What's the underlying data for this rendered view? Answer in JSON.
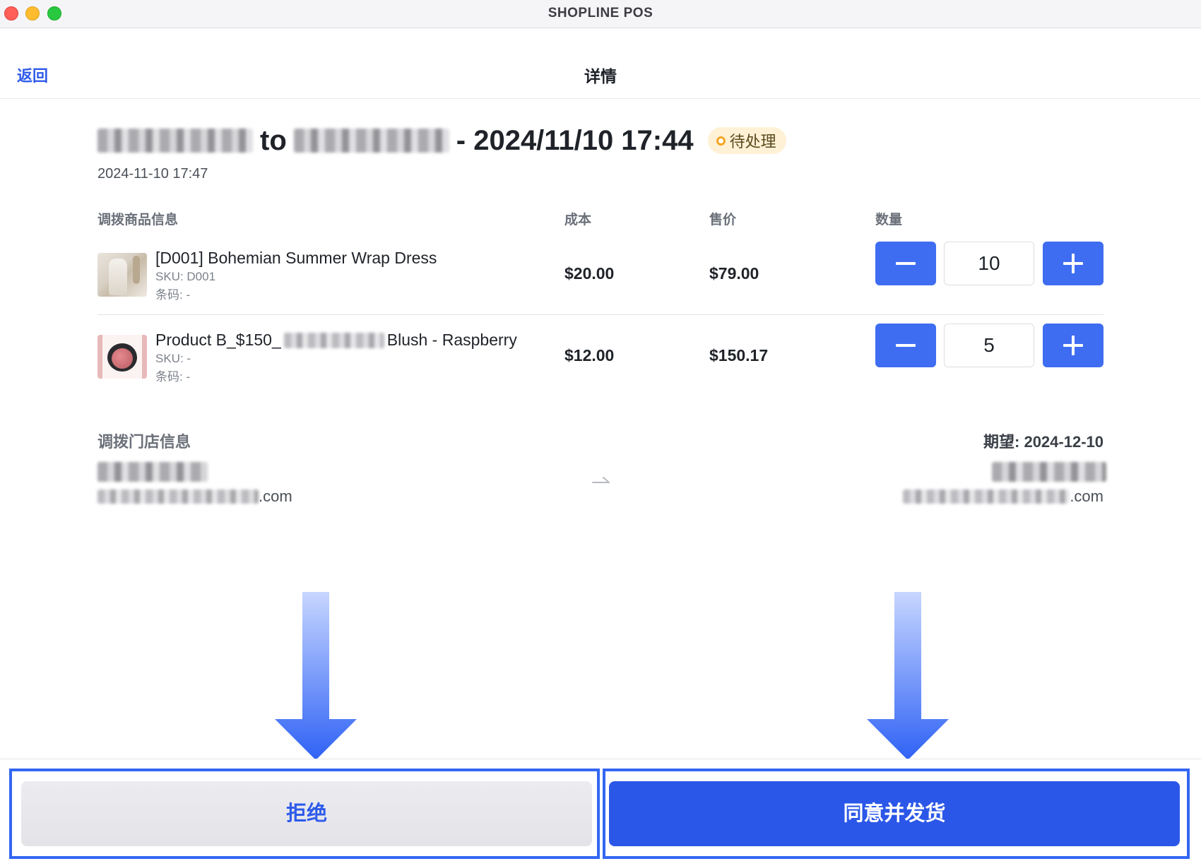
{
  "window": {
    "title": "SHOPLINE POS"
  },
  "nav": {
    "back_label": "返回",
    "title": "详情"
  },
  "transfer": {
    "connector": "to",
    "datetime": "- 2024/11/10 17:44",
    "status": "待处理",
    "created_at": "2024-11-10 17:47"
  },
  "table": {
    "headers": {
      "product": "调拨商品信息",
      "cost": "成本",
      "price": "售价",
      "quantity": "数量"
    },
    "rows": [
      {
        "name": "[D001] Bohemian Summer Wrap Dress",
        "name_prefix": "",
        "name_suffix": "",
        "sku": "SKU: D001",
        "barcode": "条码: -",
        "cost": "$20.00",
        "price": "$79.00",
        "quantity": "10"
      },
      {
        "name": "",
        "name_prefix": "Product B_$150_",
        "name_suffix": "Blush - Raspberry",
        "sku": "SKU: -",
        "barcode": "条码: -",
        "cost": "$12.00",
        "price": "$150.17",
        "quantity": "5"
      }
    ]
  },
  "store_info": {
    "label": "调拨门店信息",
    "expected": "期望: 2024-12-10",
    "from_email_suffix": ".com",
    "to_email_suffix": ".com"
  },
  "actions": {
    "reject_label": "拒绝",
    "approve_label": "同意并发货"
  },
  "colors": {
    "accent": "#2b57e8",
    "status_bg": "#fff1d6",
    "status_dot": "#f5a524",
    "highlight": "#3367f2"
  },
  "icons": {
    "minus": "minus-icon",
    "plus": "plus-icon",
    "transfer_arrow": "arrow-right-icon",
    "guide_arrow": "arrow-down-icon"
  }
}
